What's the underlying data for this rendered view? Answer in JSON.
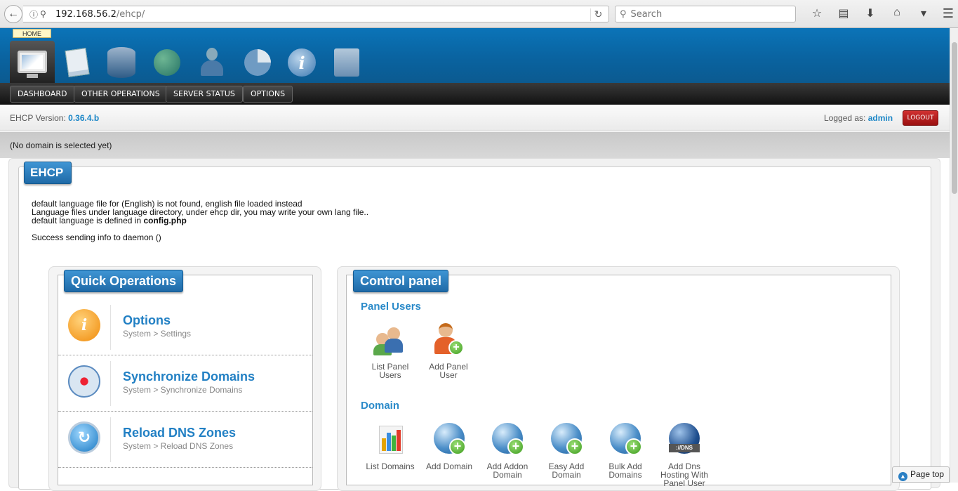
{
  "browser": {
    "url_host": "192.168.56.2",
    "url_path": "/ehcp/",
    "search_placeholder": "Search"
  },
  "header": {
    "home_label": "HOME",
    "nav": [
      "DASHBOARD",
      "OTHER OPERATIONS",
      "SERVER STATUS",
      "OPTIONS"
    ]
  },
  "version_bar": {
    "label": "EHCP Version:",
    "version": "0.36.4.b",
    "logged_label": "Logged as:",
    "user": "admin",
    "logout": "LOGOUT"
  },
  "domain_status": "(No domain is selected yet)",
  "main": {
    "title": "EHCP",
    "messages": {
      "line1": "default language file for (English) is not found, english file loaded instead",
      "line2": "Language files under language directory, under ehcp dir, you may write your own lang file..",
      "line3_prefix": "default language is defined in ",
      "line3_file": "config.php",
      "line4": "Success sending info to daemon ()"
    }
  },
  "quick_operations": {
    "title": "Quick Operations",
    "items": [
      {
        "title": "Options",
        "sub": "System > Settings"
      },
      {
        "title": "Synchronize Domains",
        "sub": "System > Synchronize Domains"
      },
      {
        "title": "Reload DNS Zones",
        "sub": "System > Reload DNS Zones"
      }
    ]
  },
  "control_panel": {
    "title": "Control panel",
    "panel_users_label": "Panel Users",
    "panel_users": [
      {
        "line1": "List Panel",
        "line2": "Users"
      },
      {
        "line1": "Add Panel",
        "line2": "User"
      }
    ],
    "domain_label": "Domain",
    "domain_items": [
      {
        "line1": "List Domains",
        "line2": ""
      },
      {
        "line1": "Add Domain",
        "line2": ""
      },
      {
        "line1": "Add Addon",
        "line2": "Domain"
      },
      {
        "line1": "Easy Add",
        "line2": "Domain"
      },
      {
        "line1": "Bulk Add",
        "line2": "Domains"
      },
      {
        "line1": "Add Dns",
        "line2": "Hosting With",
        "line3": "Panel User"
      }
    ],
    "dns_badge": "://DNS"
  },
  "page_top": "Page top"
}
